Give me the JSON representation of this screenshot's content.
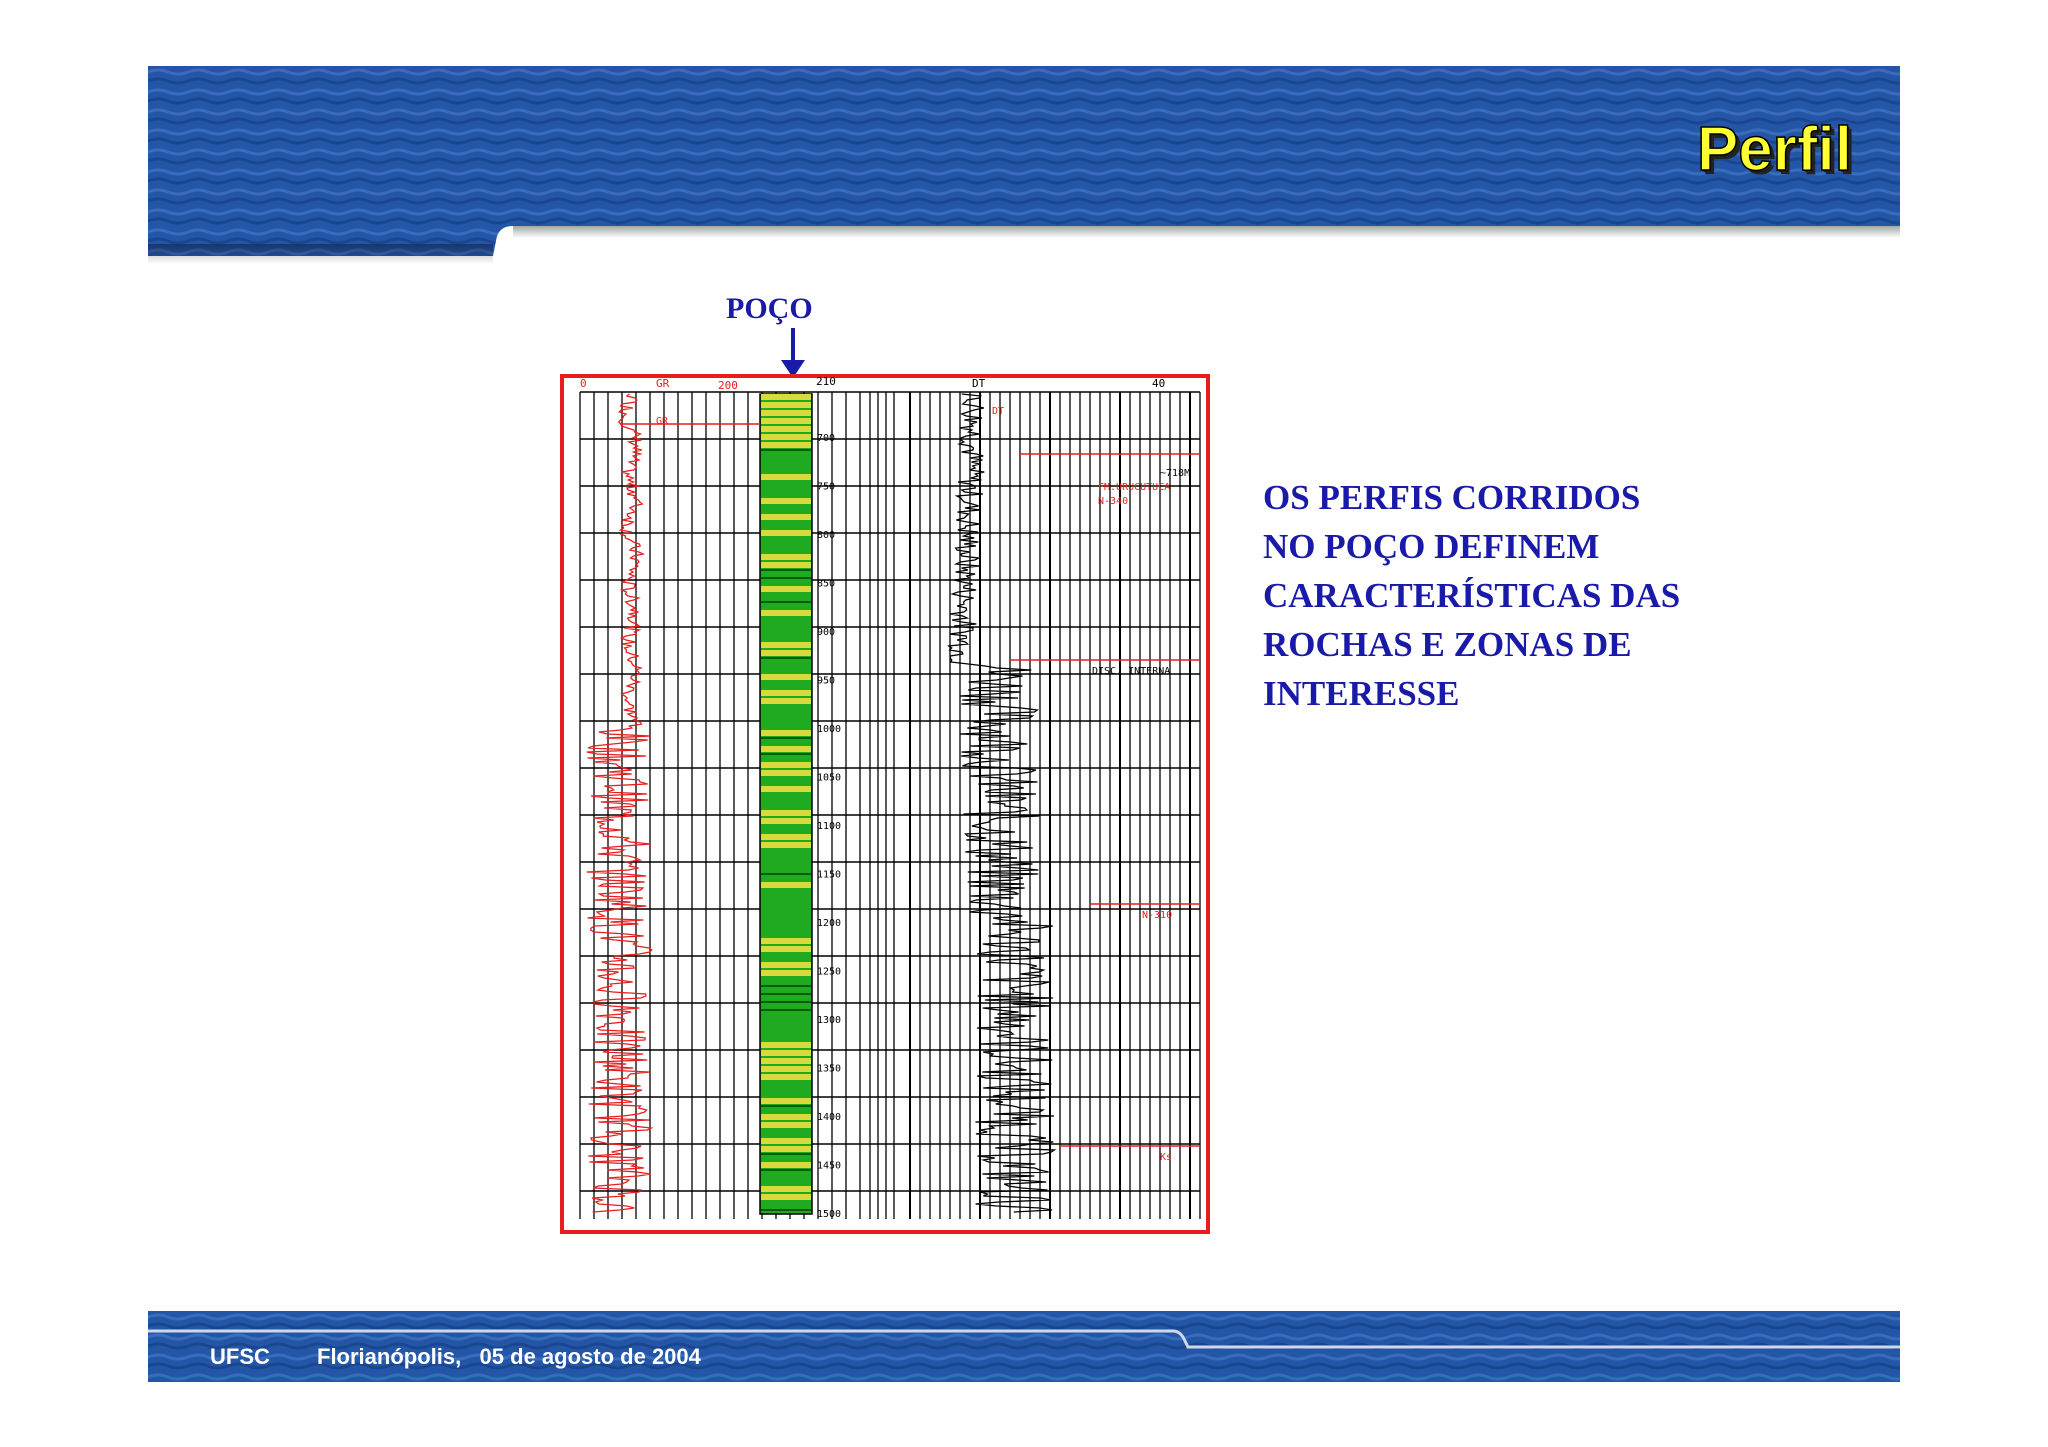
{
  "slide": {
    "title": "Perfil",
    "footer": {
      "institution": "UFSC",
      "place_date": "Florianópolis,   05 de agosto de 2004"
    },
    "well_label": "POÇO",
    "body_lines": [
      "OS PERFIS CORRIDOS",
      "NO POÇO DEFINEM",
      "CARACTERÍSTICAS DAS",
      "ROCHAS E ZONAS DE",
      "INTERESSE"
    ],
    "log": {
      "header_left": "0",
      "header_gr": "GR",
      "header_gr_max": "200",
      "header_mid": "210",
      "header_dt": "DT",
      "header_dt_max": "40",
      "curve_gr": "GR",
      "curve_dt": "DT",
      "depths": [
        "700",
        "750",
        "800",
        "850",
        "900",
        "950",
        "1000",
        "1050",
        "1100",
        "1150",
        "1200",
        "1250",
        "1300",
        "1350",
        "1400",
        "1450",
        "1500"
      ],
      "markers": [
        {
          "label": "~718M"
        },
        {
          "label": "FM.URUCUTUCA"
        },
        {
          "label": "N-340"
        },
        {
          "label": "DISC. INTERNA"
        },
        {
          "label": "N-310"
        },
        {
          "label": "Ks"
        }
      ]
    },
    "colors": {
      "header_blue": "#1f4fa3",
      "title_yellow": "#ffff33",
      "text_blue": "#1a1aa8",
      "frame_red": "#e81e1e",
      "lithology_green": "#1faa1f",
      "lithology_yellow": "#d8dc3a"
    }
  }
}
